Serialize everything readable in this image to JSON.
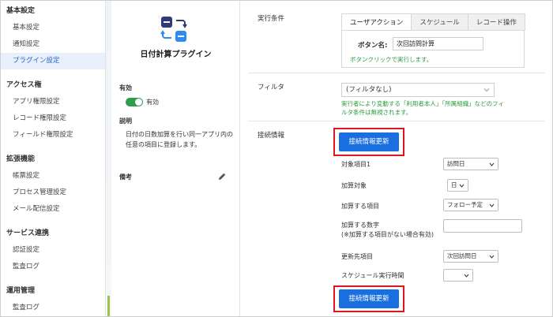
{
  "sidebar": {
    "sections": [
      {
        "title": "基本設定",
        "items": [
          "基本設定",
          "通知設定",
          "プラグイン設定"
        ]
      },
      {
        "title": "アクセス権",
        "items": [
          "アプリ権限設定",
          "レコード権限設定",
          "フィールド権限設定"
        ]
      },
      {
        "title": "拡張機能",
        "items": [
          "帳票設定",
          "プロセス管理設定",
          "メール配信設定"
        ]
      },
      {
        "title": "サービス連携",
        "items": [
          "認証設定",
          "監査ログ"
        ]
      },
      {
        "title": "運用管理",
        "items": [
          "監査ログ"
        ]
      }
    ],
    "active_item": "プラグイン設定"
  },
  "plugin": {
    "name": "日付計算プラグイン",
    "enabled_label": "有効",
    "toggle_state_label": "有効",
    "description_label": "説明",
    "description": "日付の日数加算を行い同一アプリ内の任意の項目に登録します。",
    "memo_label": "備考",
    "icon": "calendar-swap-icon",
    "toggle_on": true
  },
  "main": {
    "exec_condition_label": "実行条件",
    "tabs": [
      "ユーザアクション",
      "スケジュール",
      "レコード操作"
    ],
    "active_tab": "ユーザアクション",
    "button_name_label": "ボタン名:",
    "button_name_value": "次回訪問計算",
    "button_hint": "ボタンクリックで実行します。",
    "filter_label": "フィルタ",
    "filter_value": "(フィルタなし)",
    "filter_hint": "実行者により変動する「利用者本人」「所属組織」などのフィルタ条件は無視されます。",
    "connection_label": "接続情報",
    "update_button": "接続情報更新",
    "fields": {
      "target_label": "対象項目1",
      "target_value": "訪問日",
      "add_unit_label": "加算対象",
      "add_unit_value": "日",
      "add_field_label": "加算する項目",
      "add_field_value": "フォロー予定",
      "add_number_label": "加算する数字",
      "add_number_note": "(※加算する項目がない場合有効)",
      "dest_label": "更新先項目",
      "dest_value": "次回訪問日",
      "schedule_time_label": "スケジュール実行時間",
      "schedule_time_value": ""
    }
  },
  "colors": {
    "accent": "#1a6fe0",
    "highlight": "#e0141e",
    "success": "#2a9c3d",
    "toggle": "#2e9e4b"
  }
}
